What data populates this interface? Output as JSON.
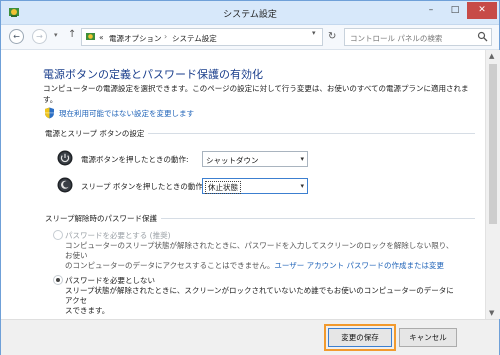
{
  "window": {
    "title": "システム設定",
    "controls": {
      "minimize": "–",
      "maximize": "□",
      "close": "✕"
    }
  },
  "address_bar": {
    "back": "←",
    "forward": "→",
    "recent": "▾",
    "up": "↑",
    "breadcrumb": {
      "overflow": "«",
      "items": [
        "電源オプション",
        "システム設定"
      ],
      "separator": "›"
    },
    "dropdown": "▾",
    "refresh": "↻",
    "search_placeholder": "コントロール パネルの検索"
  },
  "main": {
    "title": "電源ボタンの定義とパスワード保護の有効化",
    "description": "コンピューターの電源設定を選択できます。このページの設定に対して行う変更は、お使いのすべての電源プランに適用されます。",
    "unavailable_link": "現在利用可能ではない設定を変更します",
    "power_section": {
      "header": "電源とスリープ ボタンの設定",
      "rows": [
        {
          "label": "電源ボタンを押したときの動作:",
          "value": "シャットダウン"
        },
        {
          "label": "スリープ ボタンを押したときの動作:",
          "value": "休止状態"
        }
      ]
    },
    "password_section": {
      "header": "スリープ解除時のパスワード保護",
      "options": [
        {
          "label": "パスワードを必要とする (推奨)",
          "desc_line1": "コンピューターのスリープ状態が解除されたときに、パスワードを入力してスクリーンのロックを解除しない限り、お使い",
          "desc_line2": "のコンピューターのデータにアクセスすることはできません。",
          "desc_link": "ユーザー アカウント パスワードの作成または変更",
          "selected": false,
          "disabled": true
        },
        {
          "label": "パスワードを必要としない",
          "desc_line1": "スリープ状態が解除されたときに、スクリーンがロックされていないため誰でもお使いのコンピューターのデータにアクセ",
          "desc_line2": "スできます。",
          "selected": true,
          "disabled": true
        }
      ]
    }
  },
  "scrollbar": {
    "up": "▲",
    "down": "▼"
  },
  "footer": {
    "save": "変更の保存",
    "cancel": "キャンセル"
  },
  "colors": {
    "title_blue": "#1a3e8c",
    "link_blue": "#1f63b8",
    "highlight_orange": "#f29a2e",
    "close_red": "#c74b47"
  }
}
